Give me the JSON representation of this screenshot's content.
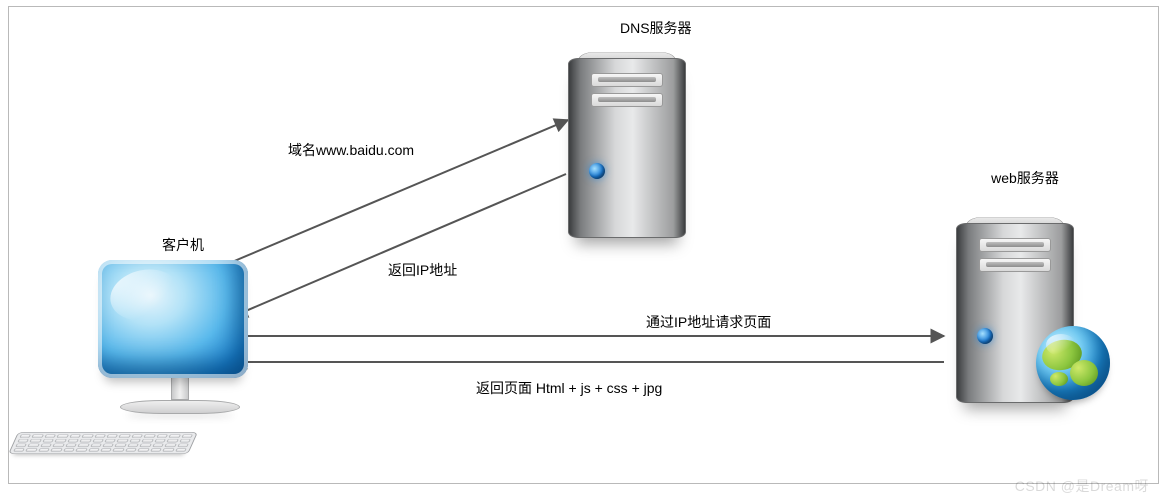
{
  "nodes": {
    "client": {
      "label": "客户机"
    },
    "dns_server": {
      "label": "DNS服务器"
    },
    "web_server": {
      "label": "web服务器"
    }
  },
  "edges": {
    "to_dns": {
      "label": "域名www.baidu.com"
    },
    "from_dns": {
      "label": "返回IP地址"
    },
    "to_web": {
      "label": "通过IP地址请求页面"
    },
    "from_web": {
      "label": "返回页面 Html + js + css + jpg"
    }
  },
  "watermark": "CSDN @是Dream呀"
}
